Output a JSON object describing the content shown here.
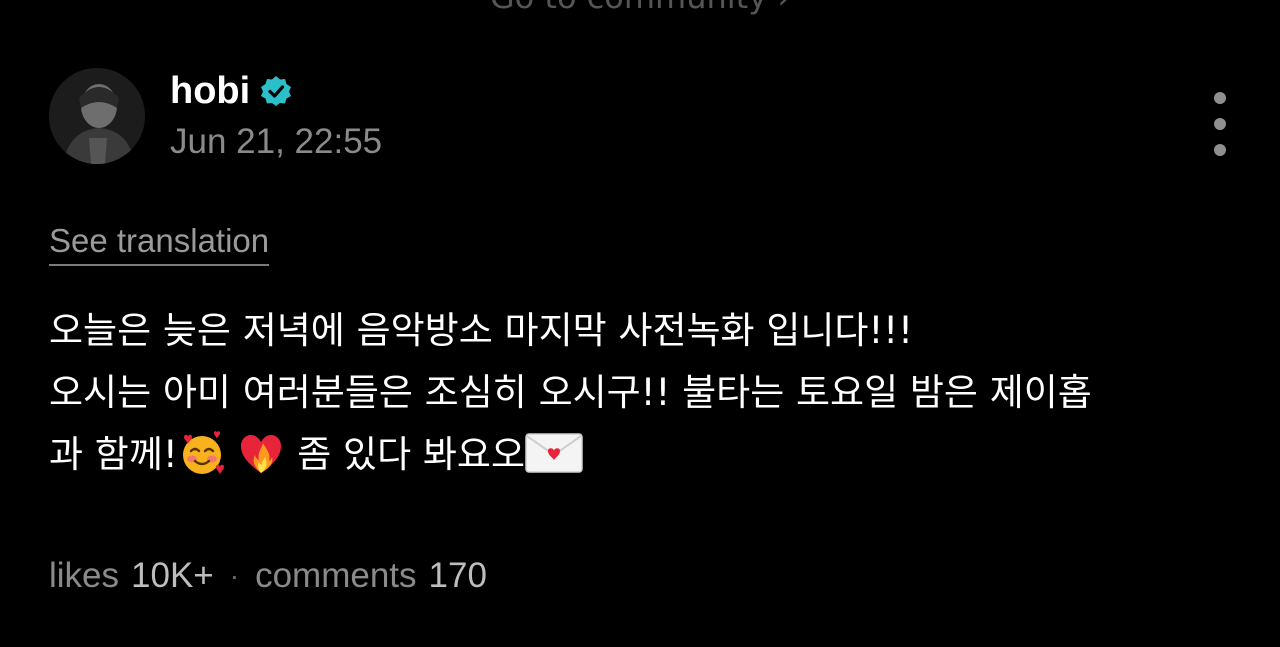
{
  "header": {
    "community_link": "Go to community"
  },
  "post": {
    "author": {
      "name": "hobi",
      "verified_color": "#2bc0c9"
    },
    "timestamp": "Jun 21, 22:55",
    "translate_label": "See translation",
    "body": {
      "line1": "오늘은 늦은 저녁에 음악방소 마지막 사전녹화 입니다!!!",
      "line2": "오시는 아미 여러분들은 조심히 오시구!! 불타는 토요일 밤은 제이홉",
      "line3a": "과 함께!",
      "line3b": " 좀 있다 봐요오"
    },
    "emoji": [
      "smiling-face-with-hearts-icon",
      "heart-on-fire-icon",
      "love-letter-icon"
    ]
  },
  "stats": {
    "likes_label": "likes",
    "likes_value": "10K+",
    "separator": "·",
    "comments_label": "comments",
    "comments_value": "170"
  }
}
